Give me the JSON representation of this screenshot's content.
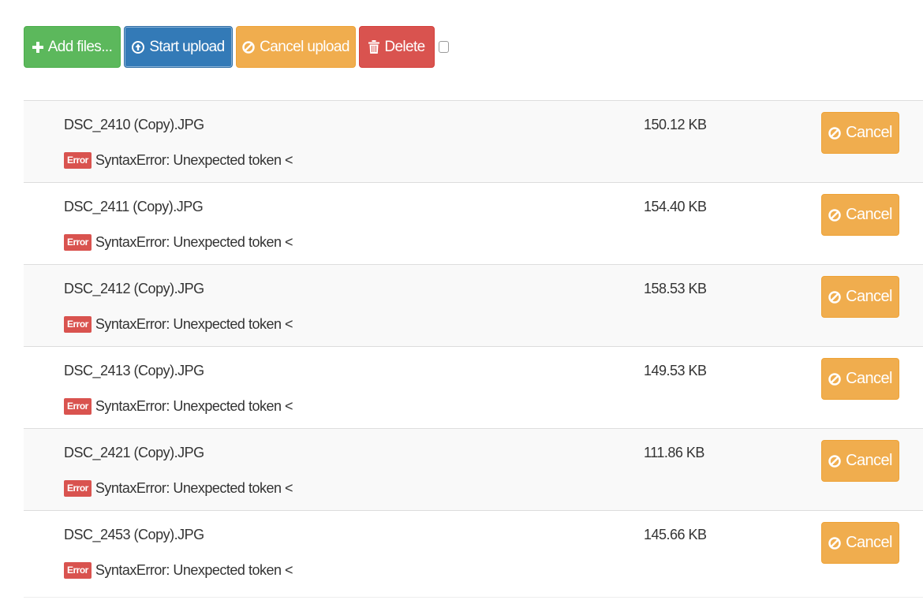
{
  "toolbar": {
    "add_files_label": "Add files...",
    "start_upload_label": "Start upload",
    "cancel_upload_label": "Cancel upload",
    "delete_label": "Delete"
  },
  "files": [
    {
      "name": "DSC_2410 (Copy).JPG",
      "size": "150.12 KB",
      "error_badge": "Error",
      "error_message": "SyntaxError: Unexpected token <",
      "cancel_label": "Cancel"
    },
    {
      "name": "DSC_2411 (Copy).JPG",
      "size": "154.40 KB",
      "error_badge": "Error",
      "error_message": "SyntaxError: Unexpected token <",
      "cancel_label": "Cancel"
    },
    {
      "name": "DSC_2412 (Copy).JPG",
      "size": "158.53 KB",
      "error_badge": "Error",
      "error_message": "SyntaxError: Unexpected token <",
      "cancel_label": "Cancel"
    },
    {
      "name": "DSC_2413 (Copy).JPG",
      "size": "149.53 KB",
      "error_badge": "Error",
      "error_message": "SyntaxError: Unexpected token <",
      "cancel_label": "Cancel"
    },
    {
      "name": "DSC_2421 (Copy).JPG",
      "size": "111.86 KB",
      "error_badge": "Error",
      "error_message": "SyntaxError: Unexpected token <",
      "cancel_label": "Cancel"
    },
    {
      "name": "DSC_2453 (Copy).JPG",
      "size": "145.66 KB",
      "error_badge": "Error",
      "error_message": "SyntaxError: Unexpected token <",
      "cancel_label": "Cancel"
    }
  ],
  "colors": {
    "success": "#5cb85c",
    "primary": "#337ab7",
    "warning": "#f0ad4e",
    "danger": "#d9534f"
  },
  "icons": {
    "add": "plus-icon",
    "start": "upload-circle-icon",
    "cancel": "ban-icon",
    "delete": "trash-icon"
  }
}
